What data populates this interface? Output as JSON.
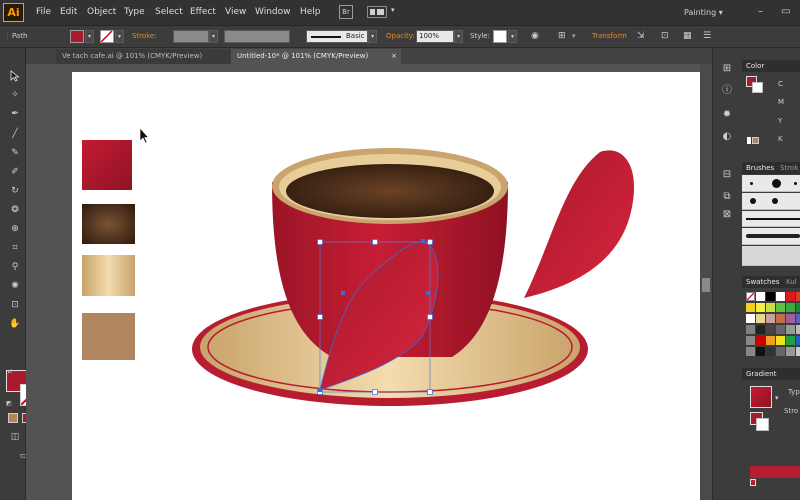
{
  "app": {
    "logo": "Ai",
    "menus": [
      "File",
      "Edit",
      "Object",
      "Type",
      "Select",
      "Effect",
      "View",
      "Window",
      "Help"
    ],
    "bridge_label": "Br",
    "workspace": "Painting",
    "workspace_arrow": "▾"
  },
  "window_controls": {
    "minimize": "–",
    "restore": "▭"
  },
  "control_bar": {
    "selection_label": "Path",
    "fill_color": "#a81a2c",
    "stroke_label": "Stroke:",
    "brush_label": "Basic",
    "opacity_label": "Opacity:",
    "opacity_value": "100%",
    "style_label": "Style:",
    "transform_label": "Transform"
  },
  "tabs": [
    {
      "label": "Ve tach cafe.ai @ 101% (CMYK/Preview)",
      "close": "×",
      "active": false
    },
    {
      "label": "Untitled-10* @ 101% (CMYK/Preview)",
      "close": "×",
      "active": true
    }
  ],
  "tools": {
    "selection": "selection-tool",
    "direct_selection": "direct-selection-tool",
    "type_glyph": "T",
    "fill_color": "#a81a2c",
    "stroke_color": "#ffffff"
  },
  "panels": {
    "color": {
      "title": "Color",
      "channels": [
        "C",
        "M",
        "Y",
        "K"
      ]
    },
    "brushes": {
      "title": "Brushes",
      "tab2": "Strok"
    },
    "swatches": {
      "title": "Swatches",
      "tab2": "Kul"
    },
    "gradient": {
      "title": "Gradient",
      "type_label": "Typ",
      "stroke_label": "Stro"
    }
  },
  "artwork": {
    "swatch_colors": [
      "#a81a2c",
      "#4a2c1a",
      "#e0c48e",
      "#b08660"
    ],
    "cup_red": "#b51a2e",
    "saucer_gold": "#e3c690",
    "coffee_brown": "#4a2a16"
  }
}
